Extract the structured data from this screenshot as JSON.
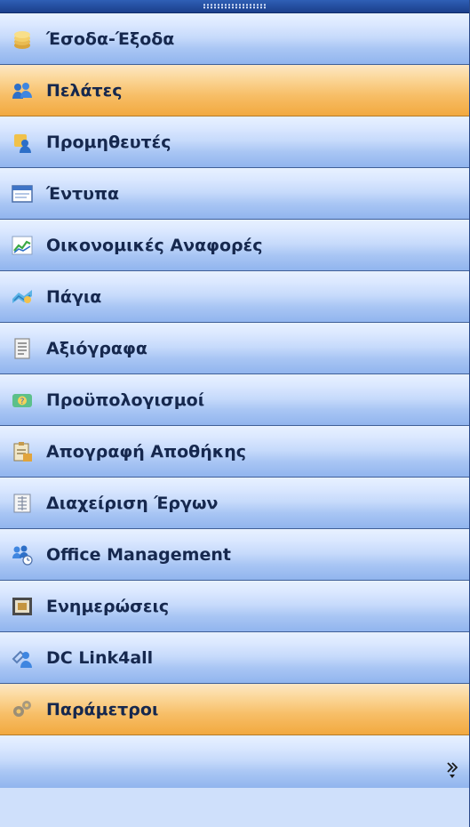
{
  "nav": {
    "items": [
      {
        "label": "Έσοδα-Έξοδα",
        "icon": "coins-icon",
        "state": "normal"
      },
      {
        "label": "Πελάτες",
        "icon": "customers-icon",
        "state": "selected"
      },
      {
        "label": "Προμηθευτές",
        "icon": "suppliers-icon",
        "state": "normal"
      },
      {
        "label": "Έντυπα",
        "icon": "forms-window-icon",
        "state": "normal"
      },
      {
        "label": "Οικονομικές Αναφορές",
        "icon": "chart-report-icon",
        "state": "normal"
      },
      {
        "label": "Πάγια",
        "icon": "assets-icon",
        "state": "normal"
      },
      {
        "label": "Αξιόγραφα",
        "icon": "securities-document-icon",
        "state": "normal"
      },
      {
        "label": "Προϋπολογισμοί",
        "icon": "budget-icon",
        "state": "normal"
      },
      {
        "label": "Απογραφή Αποθήκης",
        "icon": "inventory-icon",
        "state": "normal"
      },
      {
        "label": "Διαχείριση Έργων",
        "icon": "projects-icon",
        "state": "normal"
      },
      {
        "label": "Office Management",
        "icon": "office-management-icon",
        "state": "normal"
      },
      {
        "label": "Ενημερώσεις",
        "icon": "updates-icon",
        "state": "normal"
      },
      {
        "label": "DC Link4all",
        "icon": "dc-link-icon",
        "state": "normal"
      },
      {
        "label": "Παράμετροι",
        "icon": "settings-gears-icon",
        "state": "hot"
      }
    ]
  },
  "footer": {
    "expand_icon": "chevron-double-down-icon"
  },
  "colors": {
    "item_top": "#e8f1ff",
    "item_bottom": "#91b5ee",
    "selected_top": "#fde7c4",
    "selected_bottom": "#f2a93f",
    "label_text": "#16284e",
    "separator": "#3f5f97",
    "grip": "#1b3f8c"
  }
}
